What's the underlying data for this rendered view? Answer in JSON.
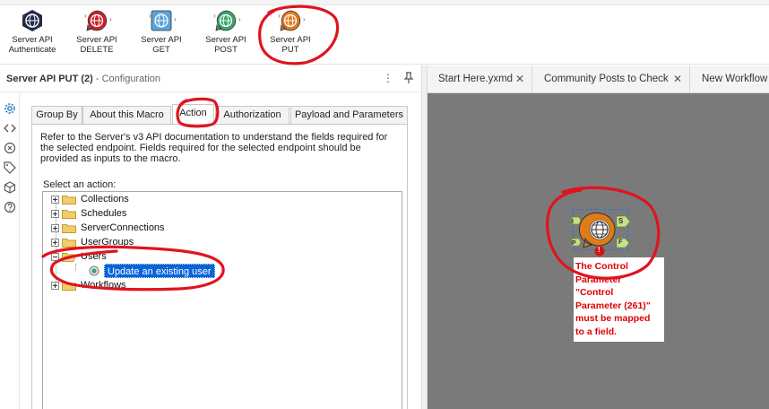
{
  "palette": {
    "tools": [
      {
        "label": "Server API\nAuthenticate",
        "color": "#1f2a44"
      },
      {
        "label": "Server API\nDELETE",
        "color": "#c8222a"
      },
      {
        "label": "Server API\nGET",
        "color": "#5aa3d9"
      },
      {
        "label": "Server API\nPOST",
        "color": "#3aa36b"
      },
      {
        "label": "Server API\nPUT",
        "color": "#e07b1a"
      }
    ]
  },
  "config": {
    "title": "Server API PUT (2)",
    "subtitle": " - Configuration",
    "more_icon": "⋮",
    "pin_icon": "📌",
    "tabs": [
      {
        "label": "Group By"
      },
      {
        "label": "About this Macro"
      },
      {
        "label": "Action"
      },
      {
        "label": "Authorization"
      },
      {
        "label": "Payload and Parameters"
      }
    ],
    "active_tab": "Action",
    "description": "Refer to the Server's v3 API documentation to understand the fields required for the selected endpoint. Fields required for the selected endpoint should be provided as inputs to the macro.",
    "select_label": "Select an action:",
    "tree": [
      {
        "label": "Collections",
        "expanded": false
      },
      {
        "label": "Schedules",
        "expanded": false
      },
      {
        "label": "ServerConnections",
        "expanded": false
      },
      {
        "label": "UserGroups",
        "expanded": false
      },
      {
        "label": "Users",
        "expanded": true
      },
      {
        "label": "Workflows",
        "expanded": false
      }
    ],
    "selected_leaf": "Update an existing user"
  },
  "documents": {
    "tabs": [
      {
        "label": "Start Here.yxmd",
        "close": "✕"
      },
      {
        "label": "Community Posts to Check",
        "close": "✕"
      },
      {
        "label": "New Workflow",
        "close": ""
      }
    ]
  },
  "canvas": {
    "node_anchors": {
      "left_top": "I",
      "left_bottom": "P",
      "right_top": "S",
      "right_bottom": "F"
    },
    "error_badge": "!",
    "error_message": "The Control\nParameter\n\"Control\nParameter (261)\"\nmust be mapped\nto a field."
  },
  "colors": {
    "annotation": "#e0141e",
    "selection": "#0a64d8",
    "canvas_bg": "#7a7a7a",
    "error_text": "#e00000"
  }
}
